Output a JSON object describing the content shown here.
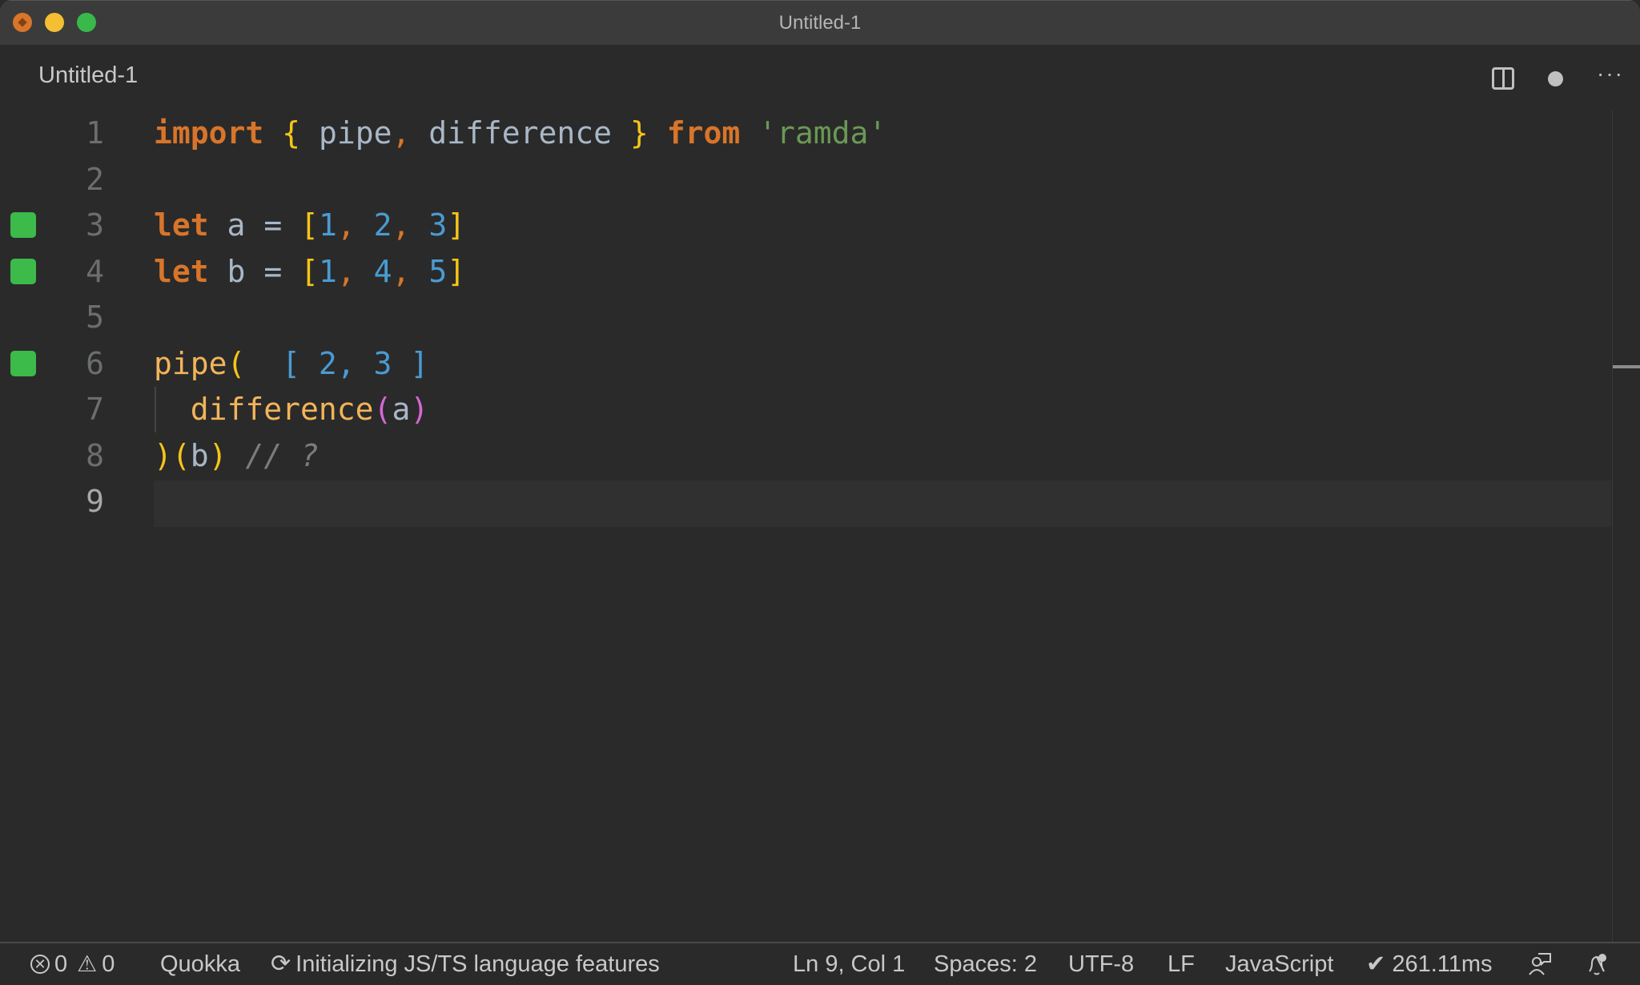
{
  "window": {
    "title": "Untitled-1",
    "traffic_lights": [
      "close",
      "minimize",
      "maximize"
    ]
  },
  "tab": {
    "label": "Untitled-1",
    "actions": [
      "split-editor-icon",
      "unsaved-dot-icon",
      "more-actions-icon"
    ],
    "more_glyph": "···"
  },
  "editor": {
    "active_line": 9,
    "lines": [
      {
        "n": "1",
        "covered": false
      },
      {
        "n": "2",
        "covered": false
      },
      {
        "n": "3",
        "covered": true
      },
      {
        "n": "4",
        "covered": true
      },
      {
        "n": "5",
        "covered": false
      },
      {
        "n": "6",
        "covered": true
      },
      {
        "n": "7",
        "covered": false
      },
      {
        "n": "8",
        "covered": false
      },
      {
        "n": "9",
        "covered": false
      }
    ],
    "tokens": {
      "l1": {
        "import": "import",
        "lbrace": "{",
        "pipe": "pipe",
        "comma": ",",
        "difference": "difference",
        "rbrace": "}",
        "from": "from",
        "module": "'ramda'"
      },
      "l3": {
        "let": "let",
        "name": "a",
        "eq": "=",
        "lb": "[",
        "v1": "1",
        "c1": ",",
        "v2": "2",
        "c2": ",",
        "v3": "3",
        "rb": "]"
      },
      "l4": {
        "let": "let",
        "name": "b",
        "eq": "=",
        "lb": "[",
        "v1": "1",
        "c1": ",",
        "v2": "4",
        "c2": ",",
        "v3": "5",
        "rb": "]"
      },
      "l6": {
        "fn": "pipe",
        "lp": "("
      },
      "l7": {
        "fn": "difference",
        "lp": "(",
        "arg": "a",
        "rp": ")"
      },
      "l8": {
        "rp": ")",
        "lp": "(",
        "arg": "b",
        "rp2": ")",
        "comment": "// ?"
      }
    },
    "inline_result": "[ 2, 3 ]",
    "colors": {
      "keyword": "#d8752a",
      "bracket": "#f5c518",
      "number": "#4a9bd1",
      "string": "#6a9955",
      "function": "#f2b45a",
      "coverage": "#3cba4a"
    }
  },
  "statusbar": {
    "errors": "0",
    "warnings": "0",
    "quokka": "Quokka",
    "sync_status": "Initializing JS/TS language features",
    "cursor": "Ln 9, Col 1",
    "indent": "Spaces: 2",
    "encoding": "UTF-8",
    "eol": "LF",
    "language": "JavaScript",
    "timing": "✔ 261.11ms"
  }
}
